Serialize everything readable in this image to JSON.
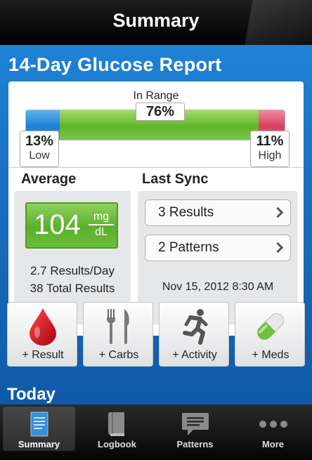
{
  "header": {
    "title": "Summary"
  },
  "report": {
    "title": "14-Day Glucose Report",
    "in_range_label": "In Range",
    "in_range_pct": "76%",
    "low_pct": "13%",
    "low_label": "Low",
    "high_pct": "11%",
    "high_label": "High",
    "colors": {
      "low": "#1e7fd2",
      "in_range": "#5fb52a",
      "high": "#d6405e"
    }
  },
  "average": {
    "title": "Average",
    "value": "104",
    "unit_top": "mg",
    "unit_bottom": "dL",
    "results_per_day": "2.7 Results/Day",
    "total_results": "38 Total Results"
  },
  "last_sync": {
    "title": "Last Sync",
    "results_button": "3 Results",
    "patterns_button": "2 Patterns",
    "date": "Nov 15, 2012 8:30 AM"
  },
  "quick_actions": [
    {
      "label": "+ Result",
      "icon": "blood-drop-icon"
    },
    {
      "label": "+ Carbs",
      "icon": "fork-knife-icon"
    },
    {
      "label": "+ Activity",
      "icon": "running-person-icon"
    },
    {
      "label": "+ Meds",
      "icon": "pill-capsule-icon"
    }
  ],
  "today": {
    "title": "Today"
  },
  "tabs": [
    {
      "label": "Summary",
      "icon": "document-icon",
      "active": true
    },
    {
      "label": "Logbook",
      "icon": "book-icon",
      "active": false
    },
    {
      "label": "Patterns",
      "icon": "speech-bubble-icon",
      "active": false
    },
    {
      "label": "More",
      "icon": "more-dots-icon",
      "active": false
    }
  ]
}
